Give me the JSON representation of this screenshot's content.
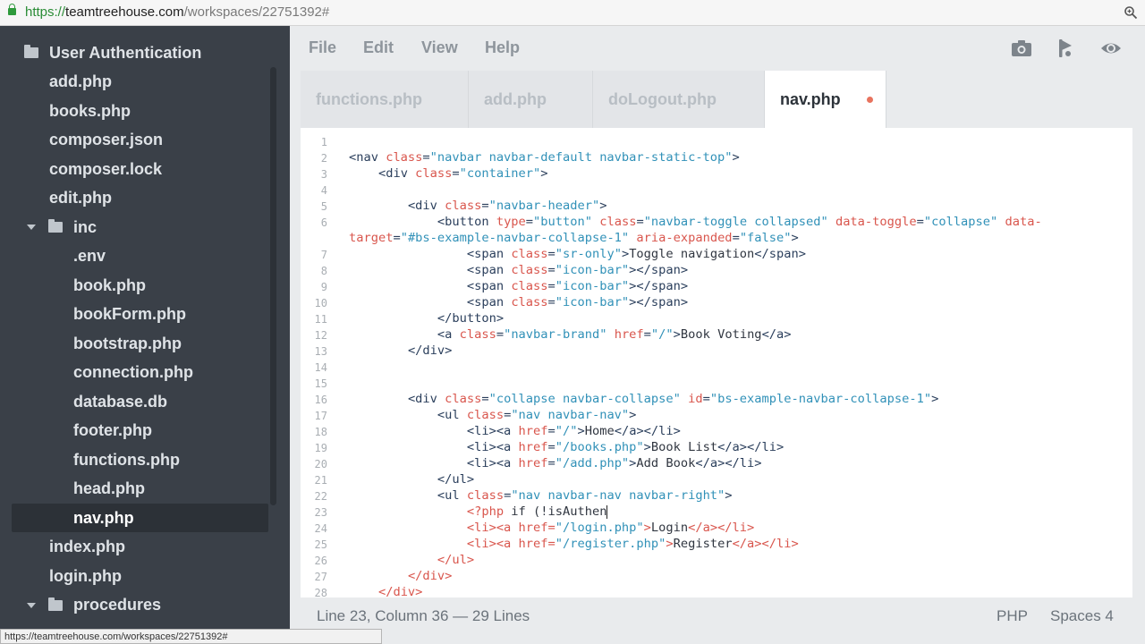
{
  "browser": {
    "url_scheme": "https://",
    "url_host": "teamtreehouse.com",
    "url_path": "/workspaces/22751392#",
    "status_url": "https://teamtreehouse.com/workspaces/22751392#"
  },
  "sidebar": {
    "items": [
      {
        "label": "User Authentication",
        "type": "folder",
        "depth": 0
      },
      {
        "label": "add.php",
        "type": "file",
        "depth": 0
      },
      {
        "label": "books.php",
        "type": "file",
        "depth": 0
      },
      {
        "label": "composer.json",
        "type": "file",
        "depth": 0
      },
      {
        "label": "composer.lock",
        "type": "file",
        "depth": 0
      },
      {
        "label": "edit.php",
        "type": "file",
        "depth": 0
      },
      {
        "label": "inc",
        "type": "folder-open",
        "depth": 0
      },
      {
        "label": ".env",
        "type": "file",
        "depth": 1
      },
      {
        "label": "book.php",
        "type": "file",
        "depth": 1
      },
      {
        "label": "bookForm.php",
        "type": "file",
        "depth": 1
      },
      {
        "label": "bootstrap.php",
        "type": "file",
        "depth": 1
      },
      {
        "label": "connection.php",
        "type": "file",
        "depth": 1
      },
      {
        "label": "database.db",
        "type": "file",
        "depth": 1
      },
      {
        "label": "footer.php",
        "type": "file",
        "depth": 1
      },
      {
        "label": "functions.php",
        "type": "file",
        "depth": 1
      },
      {
        "label": "head.php",
        "type": "file",
        "depth": 1
      },
      {
        "label": "nav.php",
        "type": "file",
        "depth": 1,
        "active": true
      },
      {
        "label": "index.php",
        "type": "file",
        "depth": 0
      },
      {
        "label": "login.php",
        "type": "file",
        "depth": 0
      },
      {
        "label": "procedures",
        "type": "folder-open",
        "depth": 0
      }
    ]
  },
  "menu": {
    "file": "File",
    "edit": "Edit",
    "view": "View",
    "help": "Help"
  },
  "toolbar": {
    "icons": [
      "camera-icon",
      "share-icon",
      "preview-eye-icon"
    ]
  },
  "tabs": [
    {
      "label": "functions.php"
    },
    {
      "label": "add.php"
    },
    {
      "label": "doLogout.php"
    },
    {
      "label": "nav.php",
      "active": true,
      "unsaved": true
    }
  ],
  "editor": {
    "line_numbers": [
      "1",
      "2",
      "3",
      "4",
      "5",
      "6",
      "",
      "7",
      "8",
      "9",
      "10",
      "11",
      "12",
      "13",
      "14",
      "15",
      "16",
      "17",
      "18",
      "19",
      "20",
      "21",
      "22",
      "23",
      "24",
      "25",
      "26",
      "27",
      "28"
    ],
    "lines": [
      [],
      [
        [
          "tag",
          "<nav "
        ],
        [
          "attr",
          "class"
        ],
        [
          "tag",
          "="
        ],
        [
          "str",
          "\"navbar navbar-default navbar-static-top\""
        ],
        [
          "tag",
          ">"
        ]
      ],
      [
        [
          "txt",
          "    "
        ],
        [
          "tag",
          "<div "
        ],
        [
          "attr",
          "class"
        ],
        [
          "tag",
          "="
        ],
        [
          "str",
          "\"container\""
        ],
        [
          "tag",
          ">"
        ]
      ],
      [],
      [
        [
          "txt",
          "        "
        ],
        [
          "tag",
          "<div "
        ],
        [
          "attr",
          "class"
        ],
        [
          "tag",
          "="
        ],
        [
          "str",
          "\"navbar-header\""
        ],
        [
          "tag",
          ">"
        ]
      ],
      [
        [
          "txt",
          "            "
        ],
        [
          "tag",
          "<button "
        ],
        [
          "attr",
          "type"
        ],
        [
          "tag",
          "="
        ],
        [
          "str",
          "\"button\""
        ],
        [
          "txt",
          " "
        ],
        [
          "attr",
          "class"
        ],
        [
          "tag",
          "="
        ],
        [
          "str",
          "\"navbar-toggle collapsed\""
        ],
        [
          "txt",
          " "
        ],
        [
          "attr",
          "data-toggle"
        ],
        [
          "tag",
          "="
        ],
        [
          "str",
          "\"collapse\""
        ],
        [
          "txt",
          " "
        ],
        [
          "attr",
          "data-"
        ]
      ],
      [
        [
          "attr",
          "target"
        ],
        [
          "tag",
          "="
        ],
        [
          "str",
          "\"#bs-example-navbar-collapse-1\""
        ],
        [
          "txt",
          " "
        ],
        [
          "attr",
          "aria-expanded"
        ],
        [
          "tag",
          "="
        ],
        [
          "str",
          "\"false\""
        ],
        [
          "tag",
          ">"
        ]
      ],
      [
        [
          "txt",
          "                "
        ],
        [
          "tag",
          "<span "
        ],
        [
          "attr",
          "class"
        ],
        [
          "tag",
          "="
        ],
        [
          "str",
          "\"sr-only\""
        ],
        [
          "tag",
          ">"
        ],
        [
          "txt",
          "Toggle navigation"
        ],
        [
          "tag",
          "</span>"
        ]
      ],
      [
        [
          "txt",
          "                "
        ],
        [
          "tag",
          "<span "
        ],
        [
          "attr",
          "class"
        ],
        [
          "tag",
          "="
        ],
        [
          "str",
          "\"icon-bar\""
        ],
        [
          "tag",
          "></span>"
        ]
      ],
      [
        [
          "txt",
          "                "
        ],
        [
          "tag",
          "<span "
        ],
        [
          "attr",
          "class"
        ],
        [
          "tag",
          "="
        ],
        [
          "str",
          "\"icon-bar\""
        ],
        [
          "tag",
          "></span>"
        ]
      ],
      [
        [
          "txt",
          "                "
        ],
        [
          "tag",
          "<span "
        ],
        [
          "attr",
          "class"
        ],
        [
          "tag",
          "="
        ],
        [
          "str",
          "\"icon-bar\""
        ],
        [
          "tag",
          "></span>"
        ]
      ],
      [
        [
          "txt",
          "            "
        ],
        [
          "tag",
          "</button>"
        ]
      ],
      [
        [
          "txt",
          "            "
        ],
        [
          "tag",
          "<a "
        ],
        [
          "attr",
          "class"
        ],
        [
          "tag",
          "="
        ],
        [
          "str",
          "\"navbar-brand\""
        ],
        [
          "txt",
          " "
        ],
        [
          "attr",
          "href"
        ],
        [
          "tag",
          "="
        ],
        [
          "str",
          "\"/\""
        ],
        [
          "tag",
          ">"
        ],
        [
          "txt",
          "Book Voting"
        ],
        [
          "tag",
          "</a>"
        ]
      ],
      [
        [
          "txt",
          "        "
        ],
        [
          "tag",
          "</div>"
        ]
      ],
      [],
      [],
      [
        [
          "txt",
          "        "
        ],
        [
          "tag",
          "<div "
        ],
        [
          "attr",
          "class"
        ],
        [
          "tag",
          "="
        ],
        [
          "str",
          "\"collapse navbar-collapse\""
        ],
        [
          "txt",
          " "
        ],
        [
          "attr",
          "id"
        ],
        [
          "tag",
          "="
        ],
        [
          "str",
          "\"bs-example-navbar-collapse-1\""
        ],
        [
          "tag",
          ">"
        ]
      ],
      [
        [
          "txt",
          "            "
        ],
        [
          "tag",
          "<ul "
        ],
        [
          "attr",
          "class"
        ],
        [
          "tag",
          "="
        ],
        [
          "str",
          "\"nav navbar-nav\""
        ],
        [
          "tag",
          ">"
        ]
      ],
      [
        [
          "txt",
          "                "
        ],
        [
          "tag",
          "<li><a "
        ],
        [
          "attr",
          "href"
        ],
        [
          "tag",
          "="
        ],
        [
          "str",
          "\"/\""
        ],
        [
          "tag",
          ">"
        ],
        [
          "txt",
          "Home"
        ],
        [
          "tag",
          "</a></li>"
        ]
      ],
      [
        [
          "txt",
          "                "
        ],
        [
          "tag",
          "<li><a "
        ],
        [
          "attr",
          "href"
        ],
        [
          "tag",
          "="
        ],
        [
          "str",
          "\"/books.php\""
        ],
        [
          "tag",
          ">"
        ],
        [
          "txt",
          "Book List"
        ],
        [
          "tag",
          "</a></li>"
        ]
      ],
      [
        [
          "txt",
          "                "
        ],
        [
          "tag",
          "<li><a "
        ],
        [
          "attr",
          "href"
        ],
        [
          "tag",
          "="
        ],
        [
          "str",
          "\"/add.php\""
        ],
        [
          "tag",
          ">"
        ],
        [
          "txt",
          "Add Book"
        ],
        [
          "tag",
          "</a></li>"
        ]
      ],
      [
        [
          "txt",
          "            "
        ],
        [
          "tag",
          "</ul>"
        ]
      ],
      [
        [
          "txt",
          "            "
        ],
        [
          "tag",
          "<ul "
        ],
        [
          "attr",
          "class"
        ],
        [
          "tag",
          "="
        ],
        [
          "str",
          "\"nav navbar-nav navbar-right\""
        ],
        [
          "tag",
          ">"
        ]
      ],
      [
        [
          "txt",
          "                "
        ],
        [
          "php",
          "<?php"
        ],
        [
          "txt",
          " if (!isAuthen"
        ],
        [
          "cursor",
          ""
        ]
      ],
      [
        [
          "txt",
          "                "
        ],
        [
          "php",
          "<li><a "
        ],
        [
          "php",
          "href"
        ],
        [
          "php",
          "="
        ],
        [
          "str",
          "\"/login.php\""
        ],
        [
          "php",
          ">"
        ],
        [
          "txt",
          "Login"
        ],
        [
          "php",
          "</a></li>"
        ]
      ],
      [
        [
          "txt",
          "                "
        ],
        [
          "php",
          "<li><a "
        ],
        [
          "php",
          "href"
        ],
        [
          "php",
          "="
        ],
        [
          "str",
          "\"/register.php\""
        ],
        [
          "php",
          ">"
        ],
        [
          "txt",
          "Register"
        ],
        [
          "php",
          "</a></li>"
        ]
      ],
      [
        [
          "txt",
          "            "
        ],
        [
          "php",
          "</ul>"
        ]
      ],
      [
        [
          "txt",
          "        "
        ],
        [
          "php",
          "</div>"
        ]
      ],
      [
        [
          "txt",
          "    "
        ],
        [
          "php",
          "</div>"
        ]
      ]
    ]
  },
  "status": {
    "position": "Line 23, Column 36 — 29 Lines",
    "language": "PHP",
    "indent": "Spaces 4"
  }
}
